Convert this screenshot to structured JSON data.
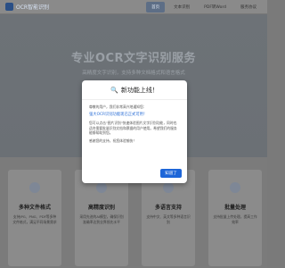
{
  "app": {
    "title": "OCR智能识别"
  },
  "nav": {
    "items": [
      {
        "label": "首页",
        "active": true
      },
      {
        "label": "文本识别"
      },
      {
        "label": "PDF转Word"
      },
      {
        "label": "服务协议"
      }
    ]
  },
  "hero": {
    "title": "专业OCR文字识别服务",
    "subtitle": "高精度文字识别，支持多种文档格式和语言格式"
  },
  "features": [
    {
      "title": "多种文件格式",
      "desc": "支持JPG、PNG、PDF等多种文件格式，满足不同场景需求"
    },
    {
      "title": "高精度识别",
      "desc": "采用先进的AI模型，确保识别准确率达到业界领先水平"
    },
    {
      "title": "多语言支持",
      "desc": "支持中文、英文等多种语言识别"
    },
    {
      "title": "批量处理",
      "desc": "支持批量上传处理，提高工作效率"
    }
  ],
  "modal": {
    "icon": "🔍",
    "title": "新功能上线！",
    "greeting": "尊敬的用户，我们非常高兴地通知您：",
    "highlight": "强大OCR识别功能现已正式可用！",
    "body": "您可以点击\"图片识别\"快速体验图片文字识别功能，同时也适合需要批量识别文档和票据的用户使用。希望我们的服务能够帮助到您。",
    "thanks": "感谢您的支持，祝您体验愉快！",
    "ok_label": "知道了"
  },
  "colors": {
    "accent": "#1e66d8",
    "highlight_text": "#2c6fd6",
    "overlay": "#7a7a7a"
  }
}
